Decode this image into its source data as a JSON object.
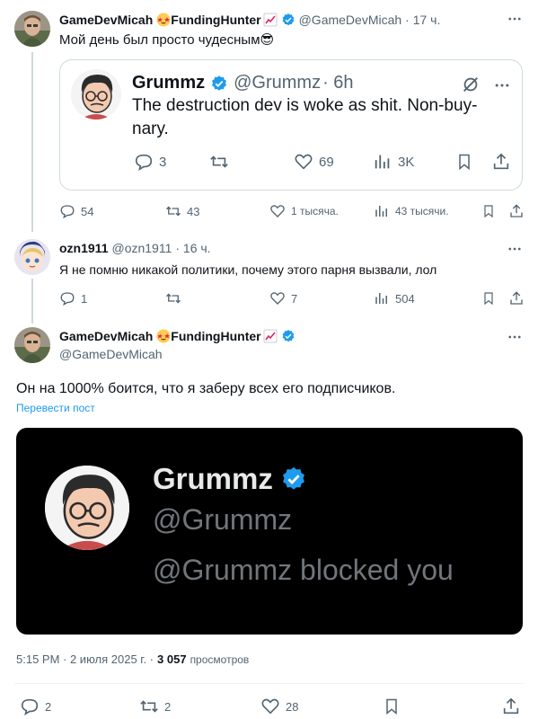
{
  "post1": {
    "author_name": "GameDevMicah",
    "author_suffix": "FundingHunter",
    "handle": "@GameDevMicah",
    "time": "· 17 ч.",
    "text": "Мой день был просто чудесным😎",
    "quote": {
      "author": "Grummz",
      "handle": "@Grummz",
      "time": "· 6h",
      "text_line1": "The destruction dev is woke as shit. Non-buy-",
      "text_line2": "nary.",
      "replies": "3",
      "likes": "69",
      "views": "3K"
    },
    "replies": "54",
    "reposts": "43",
    "likes": "1 тысяча.",
    "views": "43 тысячи."
  },
  "post2": {
    "author_name": "ozn1911",
    "handle": "@ozn1911",
    "time": "· 16 ч.",
    "text": "Я не помню никакой политики, почему этого парня вызвали, лол",
    "replies": "1",
    "likes": "7",
    "views": "504"
  },
  "main": {
    "author_name": "GameDevMicah",
    "author_suffix": "FundingHunter",
    "handle": "@GameDevMicah",
    "text": "Он на 1000% боится, что я заберу всех его подписчиков.",
    "translate": "Перевести пост",
    "image": {
      "name": "Grummz",
      "handle": "@Grummz",
      "message": "@Grummz blocked you"
    },
    "time": "5:15 PM · 2 июля 2025 г. ·",
    "views_count": "3 057",
    "views_label": "просмотров",
    "replies": "2",
    "reposts": "2",
    "likes": "28"
  },
  "colors": {
    "verified": "#1d9bf0",
    "link": "#1d9bf0",
    "muted": "#536471",
    "image_bg": "#000000"
  }
}
